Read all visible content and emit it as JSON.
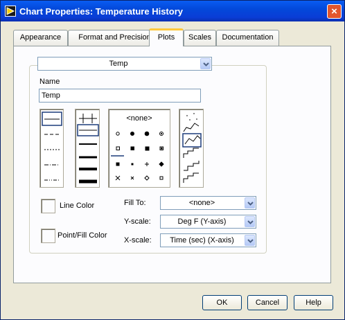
{
  "window": {
    "title": "Chart Properties: Temperature History",
    "close_glyph": "×",
    "app_icon": "labview-icon"
  },
  "tabs": [
    {
      "label": "Appearance",
      "active": false
    },
    {
      "label": "Format and Precision",
      "active": false
    },
    {
      "label": "Plots",
      "active": true
    },
    {
      "label": "Scales",
      "active": false
    },
    {
      "label": "Documentation",
      "active": false
    }
  ],
  "plots": {
    "plot_selector": "Temp",
    "name_label": "Name",
    "name_value": "Temp",
    "point_style_none": "<none>",
    "line_color_label": "Line Color",
    "point_fill_color_label": "Point/Fill Color",
    "fill_to_label": "Fill To:",
    "fill_to_value": "<none>",
    "y_scale_label": "Y-scale:",
    "y_scale_value": "Deg F (Y-axis)",
    "x_scale_label": "X-scale:",
    "x_scale_value": "Time (sec) (X-axis)"
  },
  "buttons": {
    "ok": "OK",
    "cancel": "Cancel",
    "help": "Help"
  },
  "colors": {
    "titlebar": "#0349da",
    "dialog_bg": "#ece9d8",
    "active_tab_highlight": "#ffc83c",
    "close_button": "#e3562d"
  }
}
